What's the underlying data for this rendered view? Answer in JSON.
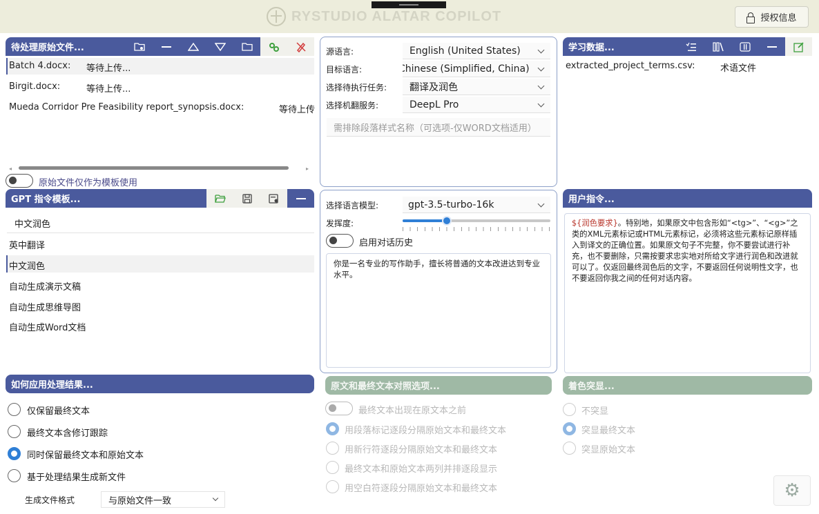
{
  "app": {
    "title": "RYSTUDIO ALATAR COPILOT",
    "auth_label": "授权信息"
  },
  "files_panel": {
    "title": "待处理原始文件...",
    "items": [
      {
        "name": "Batch 4.docx:",
        "status": "等待上传..."
      },
      {
        "name": "Birgit.docx:",
        "status": "等待上传..."
      },
      {
        "name": "Mueda Corridor Pre Feasibility report_synopsis.docx:",
        "status": "等待上传..."
      }
    ],
    "template_toggle_label": "原始文件仅作为模板使用"
  },
  "settings_panel": {
    "source_label": "源语言:",
    "source_value": "English (United States)",
    "target_label": "目标语言:",
    "target_value": "Chinese (Simplified, China)",
    "task_label": "选择待执行任务:",
    "task_value": "翻译及润色",
    "mt_label": "选择机翻服务:",
    "mt_value": "DeepL Pro",
    "exclude_placeholder": "需排除段落样式名称（可选项-仅WORD文档适用）"
  },
  "learn_panel": {
    "title": "学习数据...",
    "items": [
      {
        "name": "extracted_project_terms.csv:",
        "type": "术语文件"
      }
    ]
  },
  "gpt_panel": {
    "title": "GPT 指令模板...",
    "current": "中文润色",
    "items": [
      "英中翻译",
      "中文润色",
      "自动生成演示文稿",
      "自动生成思维导图",
      "自动生成Word文档"
    ]
  },
  "model_panel": {
    "model_label": "选择语言模型:",
    "model_value": "gpt-3.5-turbo-16k",
    "temp_label": "发挥度:",
    "temp_value": 0.3,
    "history_label": "启用对话历史",
    "system_prompt": "你是一名专业的写作助手，擅长将普通的文本改进达到专业水平。"
  },
  "user_panel": {
    "title": "用户指令...",
    "text_highlight": "${润色要求}",
    "text_body": "。特别地，如果原文中包含形如“<tg>”、“<g>”之类的XML元素标记或HTML元素标记，必须将这些元素标记原样插入到译文的正确位置。如果原文句子不完整，你不要尝试进行补充，也不要删除，只需按要求忠实地对所给文字进行润色和改进就可以了。仅返回最终润色后的文字，不要返回任何说明性文字，也不要返回你我之间的任何对话内容。"
  },
  "apply_panel": {
    "title": "如何应用处理结果...",
    "options": [
      "仅保留最终文本",
      "最终文本含修订跟踪",
      "同时保留最终文本和原始文本",
      "基于处理结果生成新文件"
    ],
    "selected": 2,
    "format_label": "生成文件格式",
    "format_value": "与原始文件一致"
  },
  "compare_panel": {
    "title": "原文和最终文本对照选项...",
    "toggle_label": "最终文本出现在原文本之前",
    "options": [
      "用段落标记逐段分隔原始文本和最终文本",
      "用新行符逐段分隔原始文本和最终文本",
      "最终文本和原始文本两列并排逐段显示",
      "用空白符逐段分隔原始文本和最终文本"
    ],
    "selected": 0
  },
  "highlight_panel": {
    "title": "着色突显...",
    "options": [
      "不突显",
      "突显最终文本",
      "突显原始文本"
    ],
    "selected": 1
  },
  "icons": {
    "files_tools": [
      "folder-gear-icon",
      "minus-icon",
      "triangle-up-icon",
      "triangle-down-icon",
      "folder-icon",
      "gears-icon",
      "pen-slash-icon"
    ],
    "learn_tools": [
      "checklist-icon",
      "books-icon",
      "columns-icon",
      "minus-icon",
      "edit-icon"
    ],
    "gpt_tools": [
      "folder-open-icon",
      "save-icon",
      "file-gear-icon",
      "minus-icon"
    ],
    "settings": "gear-icon"
  },
  "colors": {
    "header_blue": "#4a5a9d",
    "header_green": "#9fb9a5",
    "accent": "#2f7fd6",
    "topbar": "#ededdc"
  }
}
